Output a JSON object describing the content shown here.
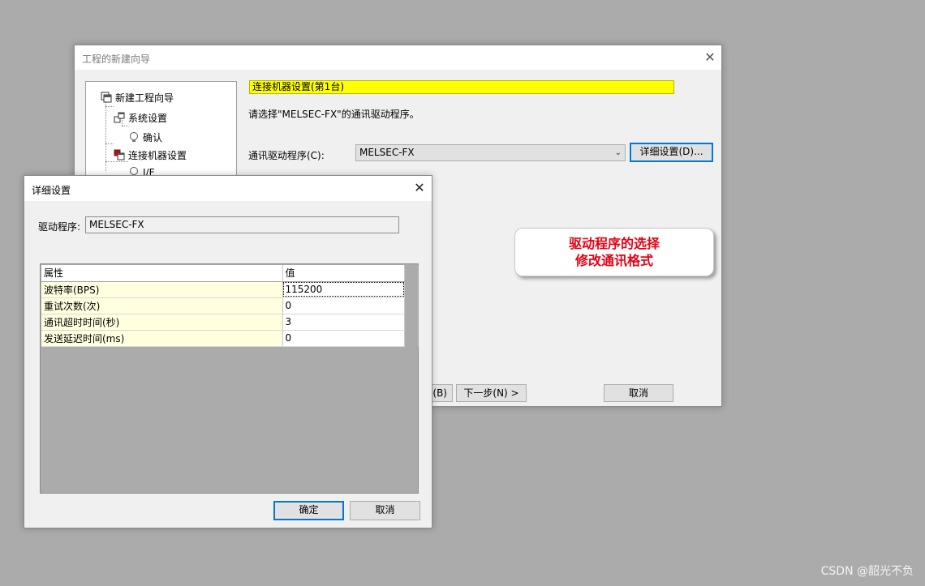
{
  "wizard": {
    "title": "工程的新建向导",
    "close_symbol": "✕",
    "tree": [
      {
        "label": "新建工程向导",
        "icon": "project-icon"
      },
      {
        "label": "系统设置",
        "icon": "system-icon"
      },
      {
        "label": "确认",
        "icon": "bulb-icon"
      },
      {
        "label": "连接机器设置",
        "icon": "device-icon"
      },
      {
        "label": "I/F",
        "icon": "bulb-icon"
      }
    ],
    "heading": "连接机器设置(第1台)",
    "instruction": "请选择\"MELSEC-FX\"的通讯驱动程序。",
    "driver_label": "通讯驱动程序(C):",
    "driver_value": "MELSEC-FX",
    "detail_button": "详细设置(D)...",
    "back_button": "(B)",
    "next_button": "下一步(N) >",
    "cancel_button": "取消"
  },
  "callout": {
    "line1": "驱动程序的选择",
    "line2": "修改通讯格式",
    "color": "#e60012"
  },
  "detail_dialog": {
    "title": "详细设置",
    "close_symbol": "✕",
    "driver_label": "驱动程序:",
    "driver_value": "MELSEC-FX",
    "columns": [
      "属性",
      "值"
    ],
    "rows": [
      {
        "prop": "波特率(BPS)",
        "value": "115200"
      },
      {
        "prop": "重试次数(次)",
        "value": "0"
      },
      {
        "prop": "通讯超时时间(秒)",
        "value": "3"
      },
      {
        "prop": "发送延迟时间(ms)",
        "value": "0"
      }
    ],
    "ok_button": "确定",
    "cancel_button": "取消"
  },
  "watermark": "CSDN @韶光不负",
  "colors": {
    "heading_bg": "#ffff00",
    "property_bg": "#ffffe0",
    "focus_border": "#0078d7"
  }
}
